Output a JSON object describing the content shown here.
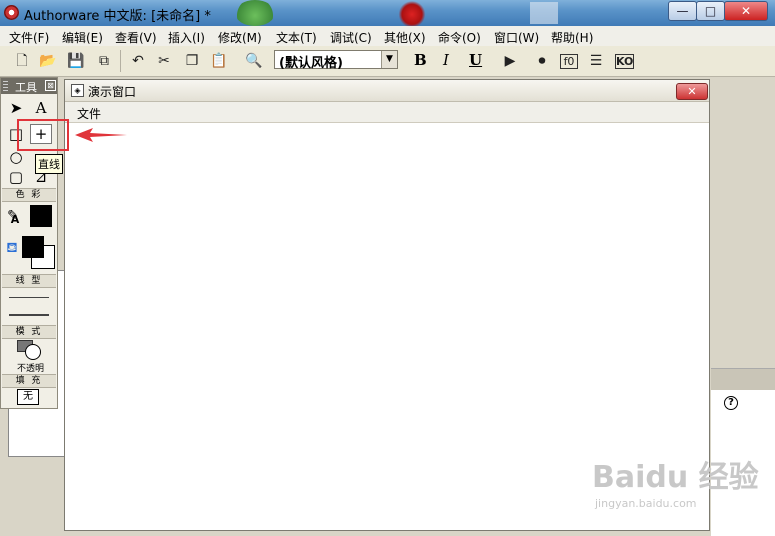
{
  "window": {
    "title": "Authorware 中文版: [未命名] *",
    "minimize": "—",
    "maximize": "□",
    "close": "✕"
  },
  "menu": [
    "文件(F)",
    "编辑(E)",
    "查看(V)",
    "插入(I)",
    "修改(M)",
    "文本(T)",
    "调试(C)",
    "其他(X)",
    "命令(O)",
    "窗口(W)",
    "帮助(H)"
  ],
  "toolbar": {
    "style_value": "(默认风格)",
    "style_dropdown_icon": "▼",
    "bold": "B",
    "italic": "I",
    "underline": "U",
    "icons": [
      "new-icon",
      "open-icon",
      "save-all-icon",
      "import-icon",
      "undo-icon",
      "cut-icon",
      "copy-icon",
      "paste-icon",
      "find-icon",
      "run-icon",
      "control-panel-icon",
      "functions-icon",
      "variables-icon",
      "knowledge-objects-icon"
    ],
    "knowledge_label": "KO",
    "functions_label": "f0"
  },
  "tools_panel": {
    "title": "工具",
    "close": "⊠",
    "section_color": "色 彩",
    "section_line": "线 型",
    "section_mode": "模 式",
    "mode_value": "不透明",
    "section_fill": "填 充",
    "fill_value": "无",
    "tooltip": "直线",
    "pointer": "➤",
    "text_tool": "A",
    "rect_tool": "□",
    "line_tool": "+",
    "oval_tool": "○",
    "round_rect_tool": "▢",
    "polygon_tool": "⊿",
    "pen_icon": "✎",
    "text_color_letter": "A"
  },
  "presentation": {
    "title": "演示窗口",
    "menu_file": "文件",
    "close": "✕"
  },
  "side_panel": {
    "help": "?"
  },
  "watermark": {
    "brand": "Baidu 经验",
    "url": "jingyan.baidu.com"
  },
  "colors": {
    "highlight": "#e0343a",
    "titlebar": "#4f87c0"
  }
}
